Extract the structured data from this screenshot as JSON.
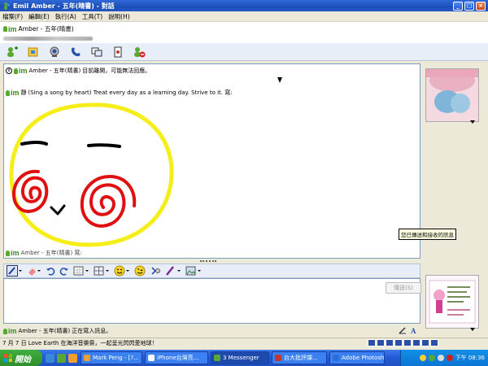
{
  "window": {
    "title": "Emil Amber - 五年(晴書) - 對話"
  },
  "menu": {
    "items": [
      "檔案(F)",
      "編輯(E)",
      "執行(A)",
      "工具(T)",
      "說明(H)"
    ]
  },
  "contact": {
    "name": "Amber - 五年(晴書)"
  },
  "toolbar": {
    "icons": [
      "invite-icon",
      "send-file-icon",
      "webcam-icon",
      "call-icon",
      "share-icon",
      "game-icon",
      "block-icon"
    ]
  },
  "conversation": {
    "info_sender": "Amber - 五年(晴書)",
    "info_status": "目前離開，可能無法回應。",
    "message_text": "(Sing a song by heart) Treat every day as a learning day. Strive to it. 寫:",
    "message_prefix": "靜",
    "bottom_sender": "Amber - 五年(晴書) 寫:"
  },
  "tooltip": {
    "text": "您已傳送和接收的訊息"
  },
  "input": {
    "send_label": "傳送(S)"
  },
  "typing": {
    "sender": "Amber - 五年(晴書)",
    "status": "正在寫入訊息。"
  },
  "statusbar": {
    "text": "7 月 7 日 Love Earth 在海洋音樂祭，一起呈光閃閃愛地球！"
  },
  "taskbar": {
    "start_label": "開始",
    "tasks": [
      {
        "label": "Mark Peng - [?...",
        "color": "#f0a030"
      },
      {
        "label": "iPhone台灣亮...",
        "color": "#ffffff"
      },
      {
        "label": "3 Messenger",
        "color": "#5aa832"
      },
      {
        "label": "台大批評課...",
        "color": "#c0392b"
      },
      {
        "label": "Adobe Photosh...",
        "color": "#2a6fd8"
      }
    ],
    "clock": "下午 08:36"
  },
  "colors": {
    "doodle_face": "#f5ee1a",
    "doodle_cheek": "#e01010",
    "doodle_ink": "#000000"
  }
}
